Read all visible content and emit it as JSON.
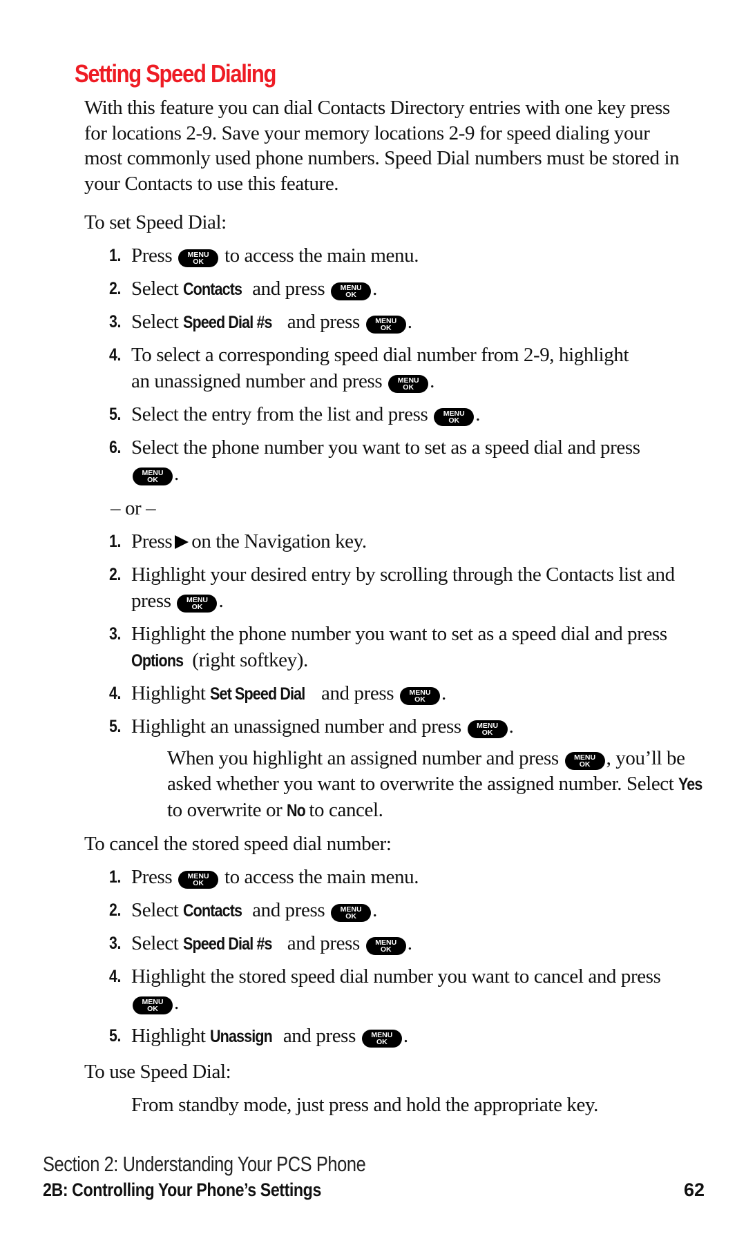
{
  "title": "Setting Speed Dialing",
  "intro": "With this feature you can dial Contacts Directory entries with one key press for locations 2-9. Save your memory locations 2-9 for speed dialing your most commonly used phone numbers. Speed Dial numbers must be stored in your Contacts to use this feature.",
  "menu_key": {
    "top": "MENU",
    "bottom": "OK"
  },
  "set_section": {
    "heading": "To set Speed Dial:",
    "steps": [
      {
        "num": "1.",
        "pre": "Press",
        "post": "to access the main menu."
      },
      {
        "num": "2.",
        "pre": "Select",
        "bold": "Contacts",
        "mid": "and press",
        "post": "."
      },
      {
        "num": "3.",
        "pre": "Select",
        "bold": "Speed Dial #s",
        "mid": "and press",
        "post": "."
      },
      {
        "num": "4.",
        "pre": "To select a corresponding speed dial number from 2-9, highlight an unassigned number and press",
        "post": "."
      },
      {
        "num": "5.",
        "pre": "Select the entry from the list and press",
        "post": "."
      },
      {
        "num": "6.",
        "pre": "Select the phone number you want to set as a speed dial and press",
        "post": "."
      }
    ]
  },
  "or_separator": "– or –",
  "alt_section": {
    "steps": [
      {
        "num": "1.",
        "pre": "Press",
        "post": "on the Navigation key."
      },
      {
        "num": "2.",
        "pre": "Highlight your desired entry by scrolling through the Contacts list and press",
        "post": "."
      },
      {
        "num": "3.",
        "pre": "Highlight the phone number you want to set as a speed dial and press",
        "bold": "Options",
        "post": "(right softkey)."
      },
      {
        "num": "4.",
        "pre": "Highlight",
        "bold": "Set Speed Dial",
        "mid": "and press",
        "post": "."
      },
      {
        "num": "5.",
        "pre": "Highlight an unassigned number and press",
        "post": "."
      }
    ],
    "note": {
      "pre": "When you highlight an assigned number and press",
      "mid": ", you’ll be asked whether you want to overwrite the assigned number. Select",
      "yes": "Yes",
      "mid2": "to overwrite or",
      "no": "No",
      "post": "to cancel."
    }
  },
  "cancel_section": {
    "heading": "To cancel the stored speed dial number:",
    "steps": [
      {
        "num": "1.",
        "pre": "Press",
        "post": "to access the main menu."
      },
      {
        "num": "2.",
        "pre": "Select",
        "bold": "Contacts",
        "mid": "and press",
        "post": "."
      },
      {
        "num": "3.",
        "pre": "Select",
        "bold": "Speed Dial #s",
        "mid": "and press",
        "post": "."
      },
      {
        "num": "4.",
        "pre": "Highlight the stored speed dial number you want to cancel and press",
        "post": "."
      },
      {
        "num": "5.",
        "pre": "Highlight",
        "bold": "Unassign",
        "mid": "and press",
        "post": "."
      }
    ]
  },
  "use_section": {
    "heading": "To use Speed Dial:",
    "text": "From standby mode, just press and hold the appropriate key."
  },
  "footer": {
    "section": "Section 2: Understanding Your PCS Phone",
    "chapter": "2B: Controlling Your Phone’s Settings",
    "page": "62"
  },
  "colors": {
    "title": "#ee1c24",
    "text": "#111111",
    "key": "#000000"
  }
}
